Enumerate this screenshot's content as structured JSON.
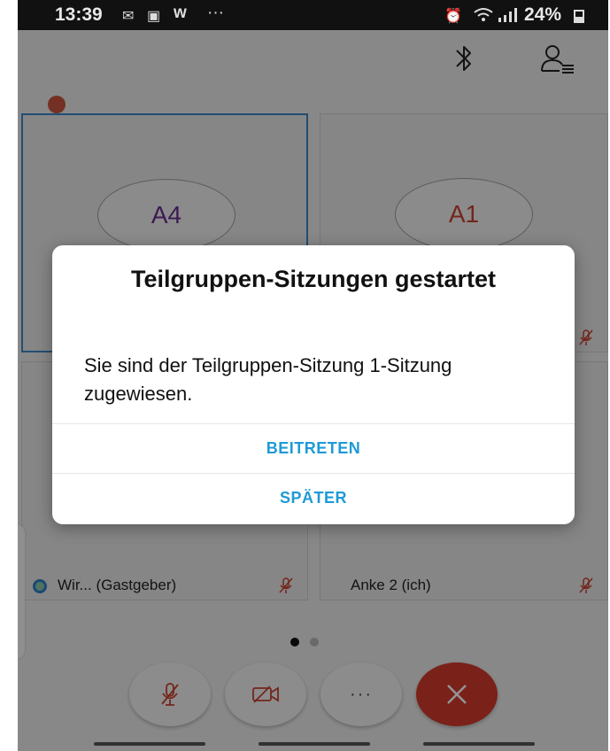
{
  "status_bar": {
    "time": "13:39",
    "app_letter": "w",
    "more": "···",
    "battery": "24%"
  },
  "tiles": [
    {
      "initials": "A4",
      "name": ""
    },
    {
      "initials": "A1",
      "name": ""
    },
    {
      "initials": "",
      "name": "Wir... (Gastgeber)"
    },
    {
      "initials": "",
      "name": "Anke 2 (ich)"
    }
  ],
  "dialog": {
    "title": "Teilgruppen-Sitzungen gestartet",
    "message": "Sie sind der Teilgruppen-Sitzung 1-Sitzung zugewiesen.",
    "join_label": "BEITRETEN",
    "later_label": "SPÄTER"
  },
  "bottom_bar": {
    "more_label": "···"
  },
  "colors": {
    "accent": "#1f9ad6",
    "end_call": "#d23a2b",
    "selected_tile_border": "#3a87c9"
  },
  "pager": {
    "pages": 2,
    "current": 1
  }
}
